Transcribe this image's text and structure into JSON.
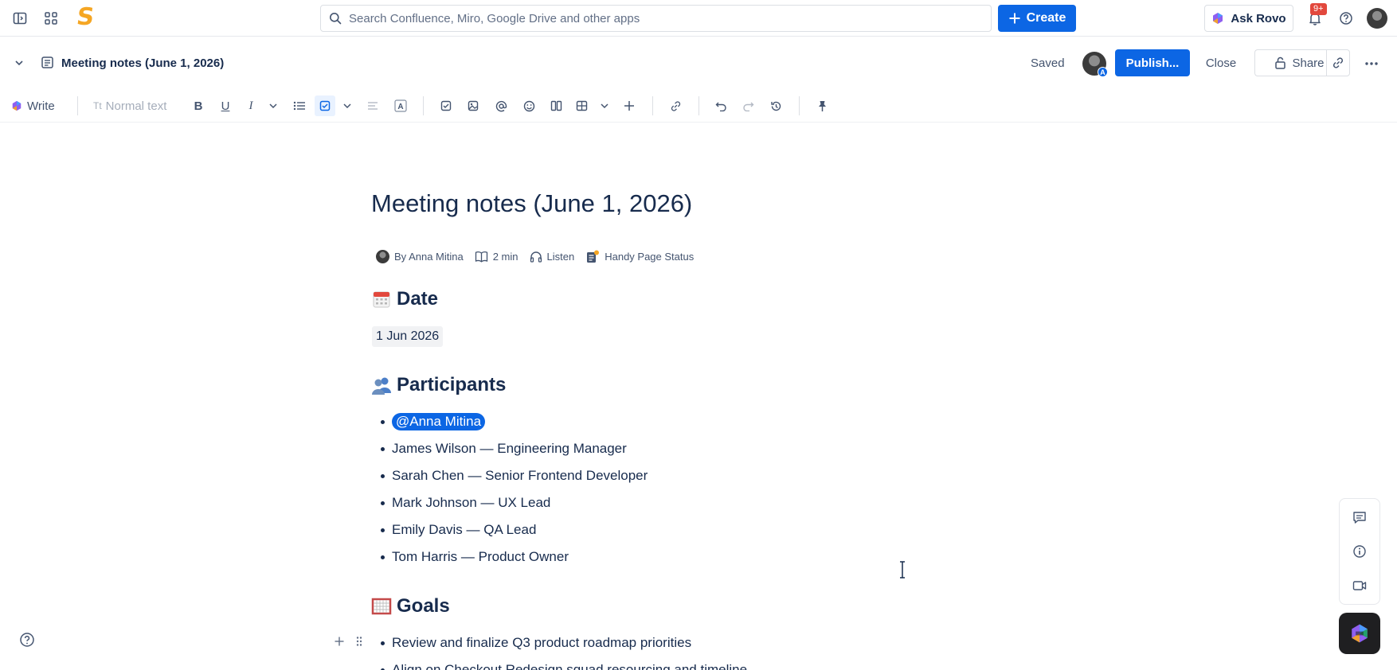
{
  "topnav": {
    "search_placeholder": "Search Confluence, Miro, Google Drive and other apps",
    "create_label": "Create",
    "ask_rovo_label": "Ask Rovo",
    "notification_badge": "9+"
  },
  "pagebar": {
    "title": "Meeting notes (June 1, 2026)",
    "saved_label": "Saved",
    "avatar_letter": "A",
    "publish_label": "Publish...",
    "close_label": "Close",
    "share_label": "Share"
  },
  "toolbar": {
    "write_label": "Write",
    "text_style": "Normal text"
  },
  "page": {
    "title": "Meeting notes (June 1, 2026)",
    "byline": {
      "author": "By Anna Mitina",
      "read_time": "2 min",
      "listen": "Listen",
      "status": "Handy Page Status"
    },
    "sections": {
      "date": {
        "heading": "Date",
        "value": "1 Jun 2026"
      },
      "participants": {
        "heading": "Participants",
        "mention": "@Anna Mitina",
        "items": [
          "James Wilson — Engineering Manager",
          "Sarah Chen — Senior Frontend Developer",
          "Mark Johnson — UX Lead",
          "Emily Davis — QA Lead",
          "Tom Harris — Product Owner"
        ]
      },
      "goals": {
        "heading": "Goals",
        "items": [
          "Review and finalize Q3 product roadmap priorities",
          "Align on Checkout Redesign squad resourcing and timeline"
        ]
      }
    }
  },
  "colors": {
    "accent": "#0c66e4",
    "text": "#172b4d",
    "muted": "#44546f",
    "logo": "#f5a623",
    "badge": "#e2483d"
  }
}
